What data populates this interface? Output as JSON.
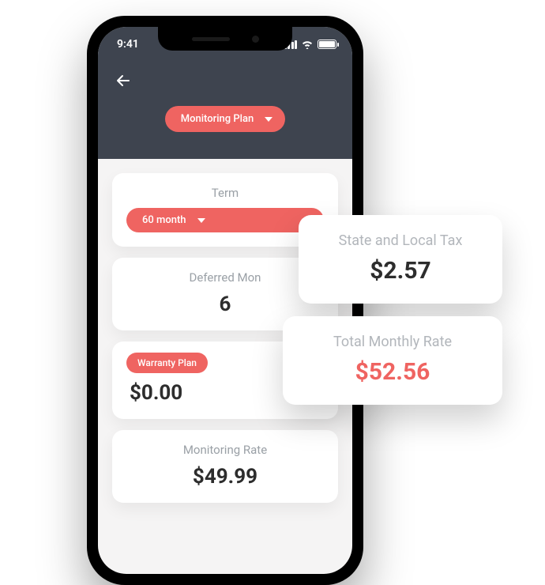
{
  "status": {
    "time": "9:41"
  },
  "header": {
    "dropdown_label": "Monitoring Plan"
  },
  "cards": {
    "term": {
      "label": "Term",
      "value": "60 month"
    },
    "deferred": {
      "label": "Deferred Mon",
      "value": "6"
    },
    "warranty": {
      "pill": "Warranty Plan",
      "value": "$0.00"
    },
    "monitoring": {
      "label": "Monitoring Rate",
      "value": "$49.99"
    }
  },
  "floats": {
    "tax": {
      "label": "State and Local Tax",
      "value": "$2.57"
    },
    "total": {
      "label": "Total Monthly Rate",
      "value": "$52.56"
    }
  },
  "colors": {
    "accent": "#ef6461",
    "header_bg": "#3e444f"
  }
}
